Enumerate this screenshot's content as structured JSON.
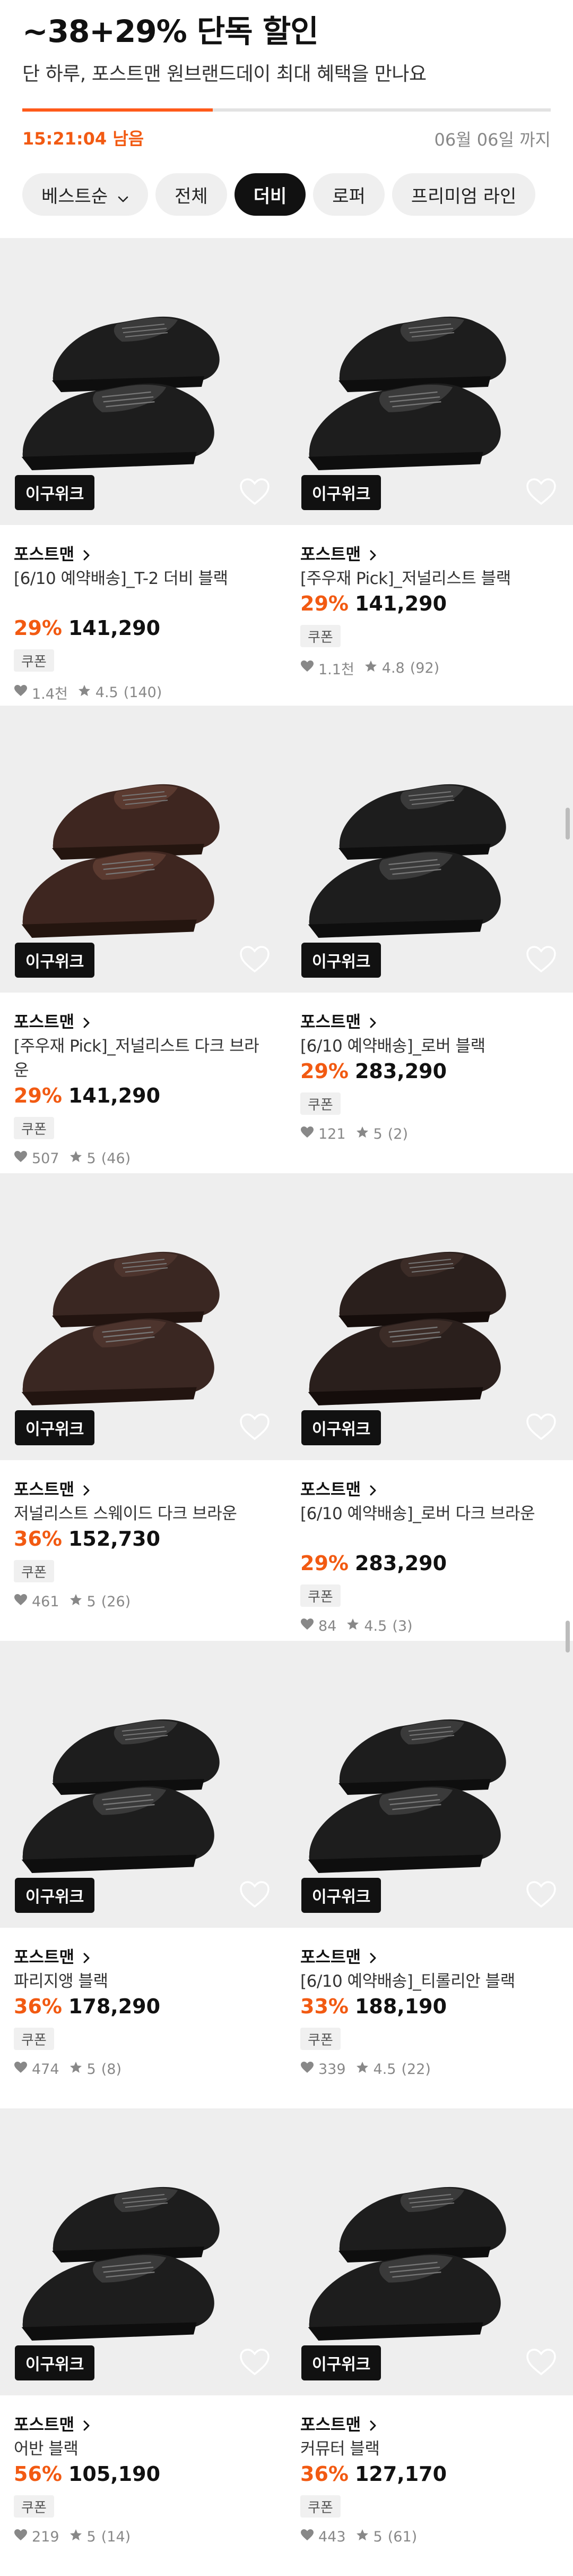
{
  "header": {
    "title": "~38+29% 단독 할인",
    "subtitle": "단 하루, 포스트맨 원브랜드데이 최대 혜택을 만나요",
    "timer": "15:21:04 남음",
    "deadline": "06월 06일 까지",
    "progress_fraction": 0.36,
    "accent_color": "#f25a12"
  },
  "chips": [
    {
      "label": "베스트순",
      "icon": "chevron-down-icon"
    },
    {
      "label": "전체"
    },
    {
      "label": "더비",
      "active": true
    },
    {
      "label": "로퍼"
    },
    {
      "label": "프리미엄 라인"
    }
  ],
  "products": [
    {
      "badge": "이구위크",
      "brand": "포스트맨",
      "name": "[6/10 예약배송]_T-2 더비 블랙",
      "discount": "29%",
      "price": "141,290",
      "coupon": "쿠폰",
      "likes": "1.4천",
      "rating": "4.5",
      "reviews": "(140)",
      "shoe": "black"
    },
    {
      "badge": "이구위크",
      "brand": "포스트맨",
      "name": "[주우재 Pick]_저널리스트 블랙",
      "discount": "29%",
      "price": "141,290",
      "coupon": "쿠폰",
      "likes": "1.1천",
      "rating": "4.8",
      "reviews": "(92)",
      "shoe": "black"
    },
    {
      "badge": "이구위크",
      "brand": "포스트맨",
      "name": "[주우재 Pick]_저널리스트 다크 브라운",
      "discount": "29%",
      "price": "141,290",
      "coupon": "쿠폰",
      "likes": "507",
      "rating": "5",
      "reviews": "(46)",
      "shoe": "brown"
    },
    {
      "badge": "이구위크",
      "brand": "포스트맨",
      "name": "[6/10 예약배송]_로버 블랙",
      "discount": "29%",
      "price": "283,290",
      "coupon": "쿠폰",
      "likes": "121",
      "rating": "5",
      "reviews": "(2)",
      "shoe": "black"
    },
    {
      "badge": "이구위크",
      "brand": "포스트맨",
      "name": "저널리스트 스웨이드 다크 브라운",
      "discount": "36%",
      "price": "152,730",
      "coupon": "쿠폰",
      "likes": "461",
      "rating": "5",
      "reviews": "(26)",
      "shoe": "suede"
    },
    {
      "badge": "이구위크",
      "brand": "포스트맨",
      "name": "[6/10 예약배송]_로버 다크 브라운",
      "discount": "29%",
      "price": "283,290",
      "coupon": "쿠폰",
      "likes": "84",
      "rating": "4.5",
      "reviews": "(3)",
      "shoe": "darkbrown"
    },
    {
      "badge": "이구위크",
      "brand": "포스트맨",
      "name": "파리지앵 블랙",
      "discount": "36%",
      "price": "178,290",
      "coupon": "쿠폰",
      "likes": "474",
      "rating": "5",
      "reviews": "(8)",
      "shoe": "black"
    },
    {
      "badge": "이구위크",
      "brand": "포스트맨",
      "name": "[6/10 예약배송]_티롤리안 블랙",
      "discount": "33%",
      "price": "188,190",
      "coupon": "쿠폰",
      "likes": "339",
      "rating": "4.5",
      "reviews": "(22)",
      "shoe": "black"
    },
    {
      "badge": "이구위크",
      "brand": "포스트맨",
      "name": "어반 블랙",
      "discount": "56%",
      "price": "105,190",
      "coupon": "쿠폰",
      "likes": "219",
      "rating": "5",
      "reviews": "(14)",
      "shoe": "black"
    },
    {
      "badge": "이구위크",
      "brand": "포스트맨",
      "name": "커뮤터 블랙",
      "discount": "36%",
      "price": "127,170",
      "coupon": "쿠폰",
      "likes": "443",
      "rating": "5",
      "reviews": "(61)",
      "shoe": "black"
    }
  ]
}
